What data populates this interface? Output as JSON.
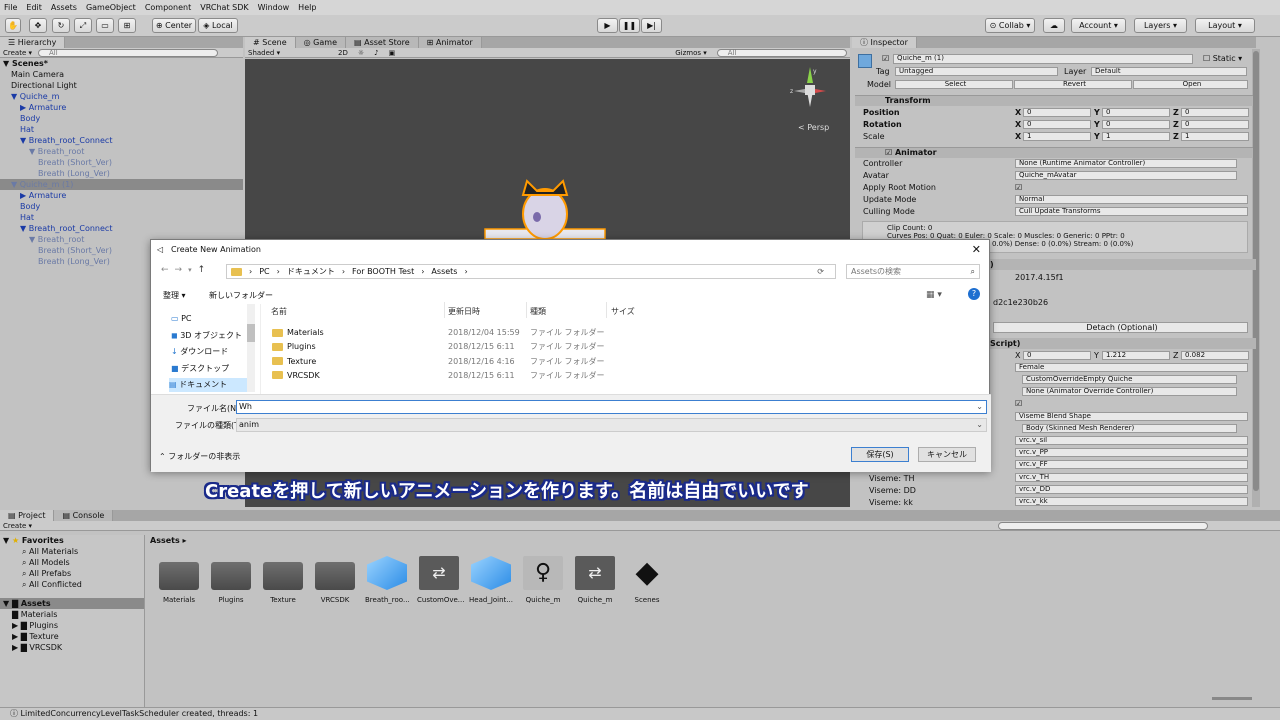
{
  "menu": [
    "File",
    "Edit",
    "Assets",
    "GameObject",
    "Component",
    "VRChat SDK",
    "Window",
    "Help"
  ],
  "toolbar": {
    "center": "Center",
    "local": "Local",
    "collab": "Collab",
    "account": "Account",
    "layers": "Layers",
    "layout": "Layout"
  },
  "hierarchy": {
    "tab": "Hierarchy",
    "create": "Create",
    "search": "All",
    "scene": "Scenes*",
    "items": [
      {
        "t": "Main Camera",
        "i": 1,
        "c": ""
      },
      {
        "t": "Directional Light",
        "i": 1,
        "c": ""
      },
      {
        "t": "Quiche_m",
        "i": 1,
        "c": "prefab"
      },
      {
        "t": "Armature",
        "i": 2,
        "c": "prefab"
      },
      {
        "t": "Body",
        "i": 2,
        "c": "prefab"
      },
      {
        "t": "Hat",
        "i": 2,
        "c": "prefab"
      },
      {
        "t": "Breath_root_Connect",
        "i": 2,
        "c": "prefab"
      },
      {
        "t": "Breath_root",
        "i": 3,
        "c": "dim"
      },
      {
        "t": "Breath (Short_Ver)",
        "i": 4,
        "c": "dim"
      },
      {
        "t": "Breath (Long_Ver)",
        "i": 4,
        "c": "dim"
      },
      {
        "t": "Quiche_m (1)",
        "i": 1,
        "c": "dim sel"
      },
      {
        "t": "Armature",
        "i": 2,
        "c": "prefab"
      },
      {
        "t": "Body",
        "i": 2,
        "c": "prefab"
      },
      {
        "t": "Hat",
        "i": 2,
        "c": "prefab"
      },
      {
        "t": "Breath_root_Connect",
        "i": 2,
        "c": "prefab"
      },
      {
        "t": "Breath_root",
        "i": 3,
        "c": "dim"
      },
      {
        "t": "Breath (Short_Ver)",
        "i": 4,
        "c": "dim"
      },
      {
        "t": "Breath (Long_Ver)",
        "i": 4,
        "c": "dim"
      }
    ]
  },
  "scene": {
    "tabs": [
      "Scene",
      "Game",
      "Asset Store",
      "Animator"
    ],
    "shaded": "Shaded",
    "mode2d": "2D",
    "gizmos": "Gizmos",
    "search": "All",
    "persp": "Persp"
  },
  "inspector": {
    "tab": "Inspector",
    "name": "Quiche_m (1)",
    "static": "Static",
    "tag_label": "Tag",
    "tag": "Untagged",
    "layer_label": "Layer",
    "layer": "Default",
    "model_label": "Model",
    "select": "Select",
    "revert": "Revert",
    "open": "Open",
    "transform": "Transform",
    "position": "Position",
    "rotation": "Rotation",
    "scale": "Scale",
    "pos": [
      "0",
      "0",
      "0"
    ],
    "rot": [
      "0",
      "0",
      "0"
    ],
    "scl": [
      "1",
      "1",
      "1"
    ],
    "animator": "Animator",
    "controller_label": "Controller",
    "controller": "None (Runtime Animator Controller)",
    "avatar_label": "Avatar",
    "avatar": "Quiche_mAvatar",
    "apply_root": "Apply Root Motion",
    "update_label": "Update Mode",
    "update": "Normal",
    "culling_label": "Culling Mode",
    "culling": "Cull Update Transforms",
    "clipcount": "Clip Count: 0",
    "curves": "Curves Pos: 0 Quat: 0 Euler: 0 Scale: 0 Muscles: 0 Generic: 0 PPtr: 0",
    "curves2": "0.0%) Dense: 0 (0.0%) Stream: 0 (0.0%)",
    "version": "2017.4.15f1",
    "guid": "d2c1e230b26",
    "detach": "Detach (Optional)",
    "script": "Script)",
    "vp": [
      "0",
      "1.212",
      "0.082"
    ],
    "female": "Female",
    "override": "CustomOverrideEmpty Quiche",
    "override2": "None (Animator Override Controller)",
    "viseme_blend": "Viseme Blend Shape",
    "body": "Body (Skinned Mesh Renderer)",
    "visemes": [
      "vrc.v_sil",
      "vrc.v_PP",
      "vrc.v_FF",
      "vrc.v_TH",
      "vrc.v_DD",
      "vrc.v_kk"
    ],
    "viseme_labels": [
      "Viseme: TH",
      "Viseme: DD",
      "Viseme: kk"
    ]
  },
  "dialog": {
    "title": "Create New Animation",
    "path": [
      "PC",
      "ドキュメント",
      "For BOOTH Test",
      "Assets"
    ],
    "search": "Assetsの検索",
    "organize": "整理",
    "newfolder": "新しいフォルダー",
    "nav": [
      "PC",
      "3D オブジェクト",
      "ダウンロード",
      "デスクトップ",
      "ドキュメント"
    ],
    "cols": [
      "名前",
      "更新日時",
      "種類",
      "サイズ"
    ],
    "files": [
      {
        "name": "Materials",
        "date": "2018/12/04 15:59",
        "type": "ファイル フォルダー"
      },
      {
        "name": "Plugins",
        "date": "2018/12/15 6:11",
        "type": "ファイル フォルダー"
      },
      {
        "name": "Texture",
        "date": "2018/12/16 4:16",
        "type": "ファイル フォルダー"
      },
      {
        "name": "VRCSDK",
        "date": "2018/12/15 6:11",
        "type": "ファイル フォルダー"
      }
    ],
    "filename_label": "ファイル名(N):",
    "filename": "Wh",
    "filetype_label": "ファイルの種類(T):",
    "filetype": "anim",
    "hide_folders": "フォルダーの非表示",
    "save": "保存(S)",
    "cancel": "キャンセル"
  },
  "subtitle": "Createを押して新しいアニメーションを作ります。名前は自由でいいです",
  "project": {
    "tabs": [
      "Project",
      "Console"
    ],
    "create": "Create",
    "favorites": "Favorites",
    "fav_items": [
      "All Materials",
      "All Models",
      "All Prefabs",
      "All Conflicted"
    ],
    "assets": "Assets",
    "asset_tree": [
      "Materials",
      "Plugins",
      "Texture",
      "VRCSDK"
    ],
    "breadcrumb": "Assets",
    "assets_grid": [
      "Materials",
      "Plugins",
      "Texture",
      "VRCSDK",
      "Breath_roo...",
      "CustomOve...",
      "Head_Joint...",
      "Quiche_m",
      "Quiche_m",
      "Scenes"
    ]
  },
  "status": "LimitedConcurrencyLevelTaskScheduler created, threads: 1"
}
